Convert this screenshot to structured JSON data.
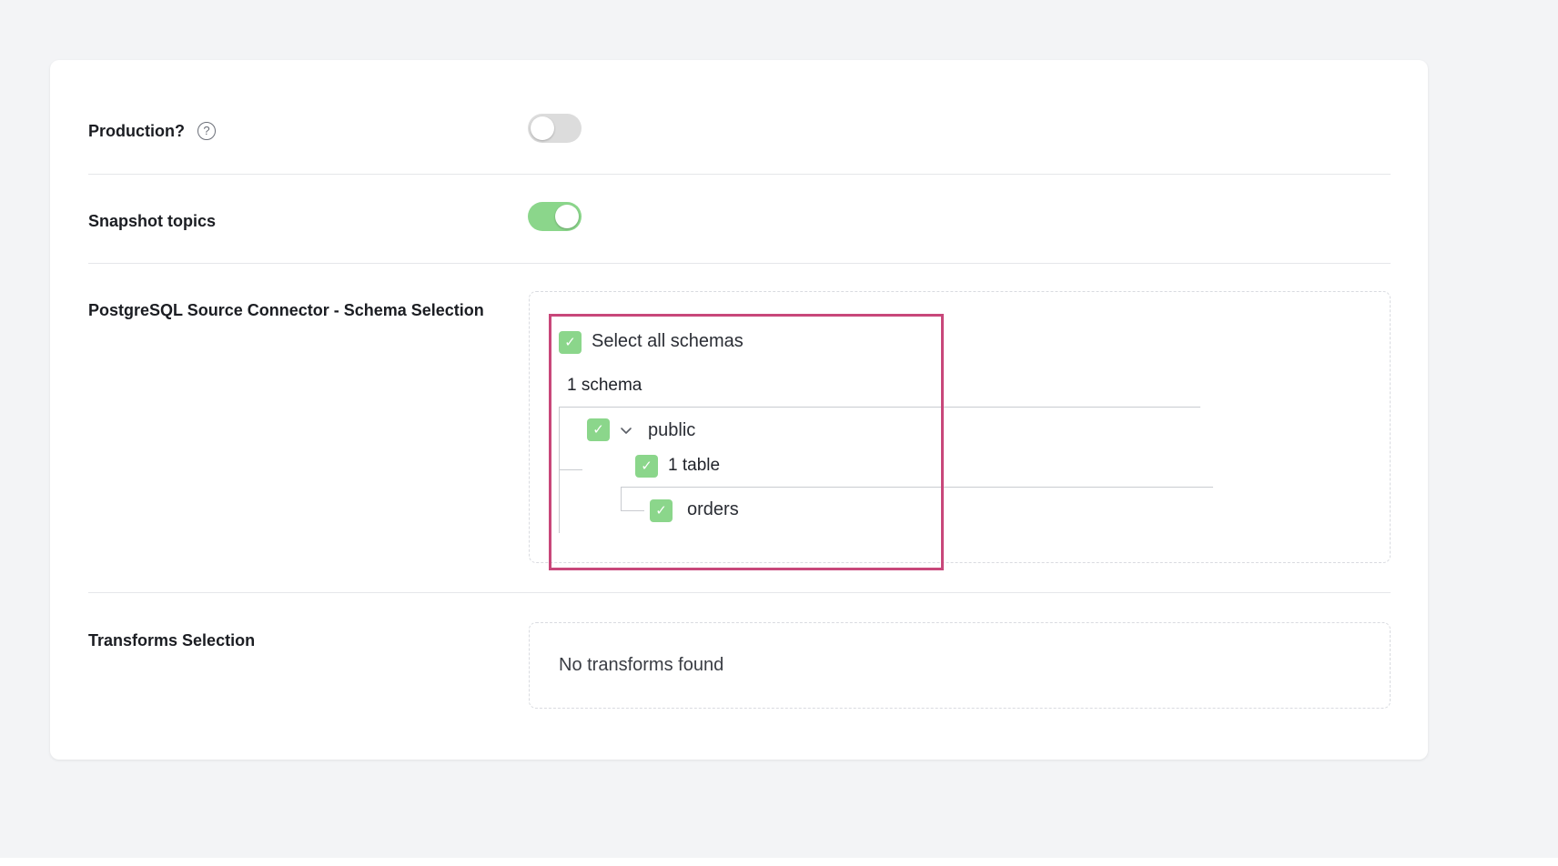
{
  "settings": {
    "production": {
      "label": "Production?",
      "help_icon": "help-circle-icon",
      "help_glyph": "?",
      "enabled": false
    },
    "snapshot_topics": {
      "label": "Snapshot topics",
      "enabled": true
    },
    "schema_selection": {
      "label": "PostgreSQL Source Connector - Schema Selection",
      "select_all_label": "Select all schemas",
      "select_all_checked": true,
      "schema_count": "1 schema",
      "schemas": [
        {
          "name": "public",
          "checked": true,
          "expanded": true,
          "table_count": "1 table",
          "tables": [
            {
              "name": "orders",
              "checked": true
            }
          ]
        }
      ]
    },
    "transforms_selection": {
      "label": "Transforms Selection",
      "empty_message": "No transforms found"
    }
  },
  "glyphs": {
    "check": "✓"
  },
  "colors": {
    "toggle_on": "#8bd68b",
    "toggle_off": "#dcdcdc",
    "checkbox": "#8bd68b",
    "highlight": "#c8477a"
  }
}
